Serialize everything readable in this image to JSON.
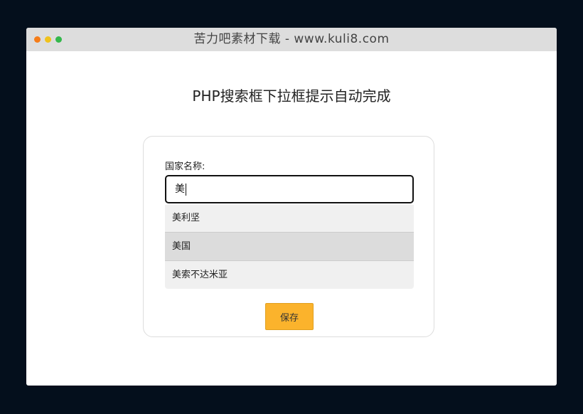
{
  "window": {
    "title": "苦力吧素材下载 - www.kuli8.com"
  },
  "page": {
    "heading": "PHP搜索框下拉框提示自动完成"
  },
  "form": {
    "label": "国家名称:",
    "input_value": "美",
    "suggestions": [
      {
        "label": "美利坚"
      },
      {
        "label": "美国"
      },
      {
        "label": "美索不达米亚"
      }
    ],
    "active_suggestion_index": 1,
    "save_label": "保存"
  },
  "colors": {
    "page_background": "#040f1c",
    "titlebar": "#dddddd",
    "traffic_red": "#f57d19",
    "traffic_yellow": "#f0c21c",
    "traffic_green": "#34b84c",
    "save_button": "#fbb32c",
    "suggestion_bg": "#f0f0f0",
    "suggestion_active_bg": "#dcdcdc"
  }
}
